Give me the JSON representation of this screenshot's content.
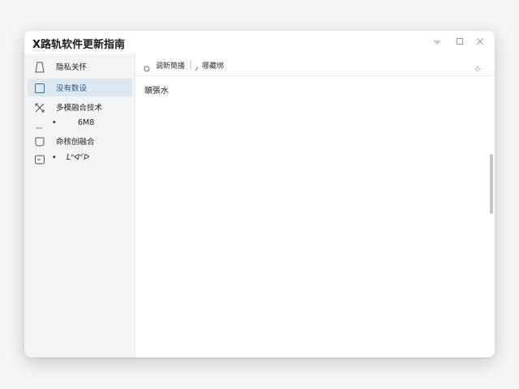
{
  "window": {
    "title": "X路轨软件更新指南",
    "controls": [
      "minimize",
      "maximize",
      "close"
    ]
  },
  "sidebar": {
    "items": [
      {
        "label": "隐私关怀",
        "icon": "bookmark-outline-icon",
        "active": false
      },
      {
        "label": "没有数设",
        "icon": "square-outline-icon",
        "active": true
      },
      {
        "label": "多模融合技术",
        "icon": "crossed-arrows-icon",
        "active": false
      },
      {
        "label": "6M8",
        "icon": "dash-icon",
        "active": false,
        "prefix": "•"
      },
      {
        "label": "命核创融合",
        "icon": "shield-outline-icon",
        "active": false
      },
      {
        "label": "ᒪᐢᐊᑉᐅ",
        "icon": "note-icon",
        "active": false,
        "prefix": "•"
      }
    ]
  },
  "toolbar": {
    "left_label": "调新簡播",
    "right_label": "哪藏绑",
    "settings_icon": "gear-icon"
  },
  "document": {
    "text": "頤張水"
  },
  "colors": {
    "accent": "#2a5b80",
    "active_bg": "#dde7ef",
    "sidebar_bg": "#f2f4f6"
  }
}
